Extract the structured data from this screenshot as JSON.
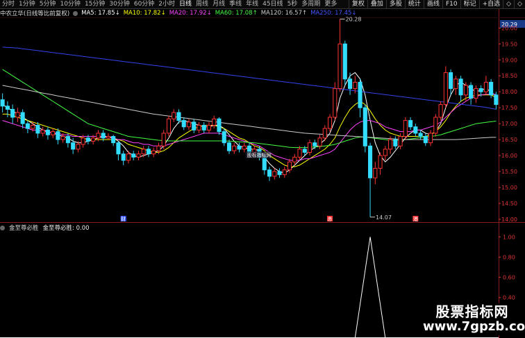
{
  "toolbar": {
    "periods": [
      "分时",
      "1分钟",
      "5分钟",
      "10分钟",
      "15分钟",
      "30分钟",
      "60分钟",
      "2小时",
      "日线",
      "周线",
      "月线",
      "季线",
      "年线",
      "45日线",
      "5秒",
      "多周期",
      "更多"
    ],
    "active_period": "日线",
    "right_buttons": [
      "复权",
      "叠加",
      "多股",
      "统计",
      "画线",
      "F10",
      "标记",
      "+自选",
      "◇",
      "◇"
    ]
  },
  "ma_legend": {
    "stock_title": "中农立华(日线等比前复权)",
    "items": [
      {
        "label": "MA5: 17.85↓",
        "color": "#ffffff"
      },
      {
        "label": "MA10: 17.82↓",
        "color": "#ffff00"
      },
      {
        "label": "MA20: 17.92↓",
        "color": "#ff44ff"
      },
      {
        "label": "MA60: 17.08↑",
        "color": "#44ff44"
      },
      {
        "label": "MA120: 16.57↑",
        "color": "#cccccc"
      },
      {
        "label": "MA250: 17.45↓",
        "color": "#4455ff"
      }
    ]
  },
  "price_axis": {
    "labels": [
      "20.29",
      "20.00",
      "19.50",
      "19.00",
      "18.50",
      "18.00",
      "17.50",
      "17.00",
      "16.50",
      "16.00",
      "15.50",
      "15.00",
      "14.50",
      "14.00"
    ],
    "current": "20.29"
  },
  "annotations": {
    "high_label": "20.28",
    "low_label": "14.07",
    "marker_1": "财",
    "marker_2": "赤",
    "marker_3": "港",
    "chip_label": "股标指标网"
  },
  "indicator": {
    "name": "金至尊必胜",
    "line_label": "金至尊必胜: 0.00",
    "axis_labels": [
      "1.00",
      "0.80",
      "0.60",
      "0.40",
      "0.20"
    ]
  },
  "watermark": {
    "line1": "股票指标网",
    "line2": "www.7gpzb.com"
  },
  "chart_data": {
    "type": "candlestick",
    "up_color": "#ff3333",
    "down_color": "#33ddff",
    "candles": [
      [
        17.75,
        17.55,
        17.95,
        17.35
      ],
      [
        17.55,
        17.45,
        17.7,
        17.2
      ],
      [
        17.45,
        17.2,
        17.6,
        17.0
      ],
      [
        17.2,
        17.35,
        17.5,
        17.05
      ],
      [
        17.35,
        17.0,
        17.45,
        16.85
      ],
      [
        17.0,
        16.85,
        17.1,
        16.7
      ],
      [
        16.85,
        16.95,
        17.05,
        16.75
      ],
      [
        16.95,
        16.7,
        17.05,
        16.55
      ],
      [
        16.7,
        16.8,
        16.9,
        16.6
      ],
      [
        16.8,
        16.65,
        16.9,
        16.5
      ],
      [
        16.65,
        16.75,
        16.85,
        16.55
      ],
      [
        16.75,
        16.5,
        16.85,
        16.35
      ],
      [
        16.5,
        16.6,
        16.7,
        16.4
      ],
      [
        16.6,
        16.4,
        16.7,
        16.25
      ],
      [
        16.4,
        16.2,
        16.55,
        16.05
      ],
      [
        16.2,
        16.35,
        16.45,
        16.1
      ],
      [
        16.35,
        16.55,
        16.65,
        16.25
      ],
      [
        16.55,
        16.45,
        16.65,
        16.35
      ],
      [
        16.45,
        16.55,
        16.65,
        16.35
      ],
      [
        16.55,
        16.7,
        16.8,
        16.45
      ],
      [
        16.7,
        16.55,
        16.8,
        16.45
      ],
      [
        16.55,
        16.6,
        16.7,
        16.5
      ],
      [
        16.6,
        16.4,
        16.65,
        16.3
      ],
      [
        16.4,
        16.05,
        16.45,
        15.85
      ],
      [
        16.05,
        15.85,
        16.15,
        15.7
      ],
      [
        15.85,
        16.05,
        16.15,
        15.75
      ],
      [
        16.05,
        15.95,
        16.15,
        15.85
      ],
      [
        15.95,
        16.05,
        16.15,
        15.85
      ],
      [
        16.05,
        16.2,
        16.3,
        15.95
      ],
      [
        16.2,
        16.05,
        16.3,
        15.95
      ],
      [
        16.05,
        16.15,
        16.25,
        15.95
      ],
      [
        16.15,
        16.3,
        16.4,
        16.05
      ],
      [
        16.3,
        16.7,
        16.8,
        16.2
      ],
      [
        16.7,
        17.15,
        17.25,
        16.6
      ],
      [
        17.15,
        17.35,
        17.45,
        17.05
      ],
      [
        17.35,
        17.1,
        17.45,
        17.0
      ],
      [
        17.1,
        16.9,
        17.2,
        16.8
      ],
      [
        16.9,
        17.05,
        17.15,
        16.8
      ],
      [
        17.05,
        16.8,
        17.15,
        16.7
      ],
      [
        16.8,
        16.95,
        17.05,
        16.7
      ],
      [
        16.95,
        16.8,
        17.05,
        16.7
      ],
      [
        16.8,
        16.95,
        17.05,
        16.7
      ],
      [
        16.95,
        17.15,
        17.25,
        16.85
      ],
      [
        17.15,
        16.75,
        17.2,
        16.65
      ],
      [
        16.75,
        16.4,
        16.85,
        16.3
      ],
      [
        16.4,
        16.15,
        16.5,
        16.05
      ],
      [
        16.15,
        16.3,
        16.4,
        16.05
      ],
      [
        16.3,
        16.2,
        16.4,
        16.1
      ],
      [
        16.2,
        16.3,
        16.4,
        16.1
      ],
      [
        16.3,
        16.1,
        16.4,
        16.0
      ],
      [
        16.1,
        16.2,
        16.3,
        16.0
      ],
      [
        16.2,
        15.95,
        16.3,
        15.85
      ],
      [
        15.95,
        15.55,
        16.05,
        15.4
      ],
      [
        15.55,
        15.35,
        15.65,
        15.2
      ],
      [
        15.35,
        15.5,
        15.6,
        15.25
      ],
      [
        15.5,
        15.4,
        15.6,
        15.3
      ],
      [
        15.4,
        15.55,
        15.65,
        15.3
      ],
      [
        15.55,
        15.8,
        15.9,
        15.45
      ],
      [
        15.8,
        15.95,
        16.05,
        15.7
      ],
      [
        15.95,
        16.2,
        16.3,
        15.85
      ],
      [
        16.2,
        16.1,
        16.3,
        16.0
      ],
      [
        16.1,
        16.4,
        16.5,
        16.0
      ],
      [
        16.4,
        16.3,
        16.5,
        16.2
      ],
      [
        16.3,
        16.55,
        16.65,
        16.2
      ],
      [
        16.55,
        16.85,
        16.95,
        16.45
      ],
      [
        16.85,
        17.2,
        17.3,
        16.75
      ],
      [
        17.2,
        18.1,
        18.3,
        17.1
      ],
      [
        18.1,
        19.5,
        20.28,
        18.0
      ],
      [
        19.5,
        18.4,
        19.6,
        18.2
      ],
      [
        18.4,
        18.1,
        18.6,
        17.9
      ],
      [
        18.1,
        18.3,
        18.5,
        17.95
      ],
      [
        18.3,
        17.5,
        18.4,
        17.2
      ],
      [
        17.5,
        16.3,
        17.6,
        16.1
      ],
      [
        16.3,
        15.3,
        16.4,
        14.07
      ],
      [
        15.3,
        15.6,
        15.8,
        15.1
      ],
      [
        15.6,
        16.0,
        16.1,
        15.4
      ],
      [
        16.0,
        16.2,
        16.3,
        15.85
      ],
      [
        16.2,
        16.5,
        16.6,
        16.05
      ],
      [
        16.5,
        16.3,
        16.6,
        16.2
      ],
      [
        16.3,
        16.6,
        16.7,
        16.2
      ],
      [
        16.6,
        17.1,
        17.2,
        16.5
      ],
      [
        17.1,
        16.9,
        17.2,
        16.8
      ],
      [
        16.9,
        16.7,
        17.0,
        16.6
      ],
      [
        16.7,
        16.6,
        16.8,
        16.5
      ],
      [
        16.6,
        16.4,
        16.7,
        16.3
      ],
      [
        16.4,
        16.7,
        16.8,
        16.3
      ],
      [
        16.7,
        17.2,
        17.3,
        16.6
      ],
      [
        17.2,
        17.6,
        17.7,
        17.1
      ],
      [
        17.6,
        18.6,
        18.8,
        17.5
      ],
      [
        18.6,
        18.1,
        18.7,
        17.9
      ],
      [
        18.1,
        18.4,
        18.5,
        17.9
      ],
      [
        18.4,
        17.9,
        18.5,
        17.7
      ],
      [
        17.9,
        18.2,
        18.3,
        17.7
      ],
      [
        18.2,
        17.8,
        18.3,
        17.6
      ],
      [
        17.8,
        18.1,
        18.2,
        17.65
      ],
      [
        18.1,
        18.0,
        18.2,
        17.85
      ],
      [
        18.0,
        18.3,
        18.5,
        17.9
      ],
      [
        18.3,
        17.9,
        18.4,
        17.8
      ],
      [
        17.9,
        17.6,
        18.0,
        17.45
      ]
    ],
    "ma_series": [
      {
        "color": "#ffffff",
        "values": [
          17.6,
          17.5,
          17.4,
          17.3,
          17.2,
          17.1,
          17.0,
          16.9,
          16.8,
          16.75,
          16.7,
          16.65,
          16.6,
          16.55,
          16.45,
          16.4,
          16.4,
          16.45,
          16.5,
          16.55,
          16.6,
          16.6,
          16.55,
          16.45,
          16.3,
          16.1,
          16.0,
          15.95,
          16.0,
          16.05,
          16.1,
          16.15,
          16.3,
          16.55,
          16.85,
          17.05,
          17.1,
          17.05,
          17.0,
          16.95,
          16.9,
          16.9,
          16.95,
          16.95,
          16.85,
          16.65,
          16.45,
          16.3,
          16.25,
          16.2,
          16.2,
          16.15,
          15.95,
          15.75,
          15.6,
          15.5,
          15.45,
          15.55,
          15.7,
          15.85,
          16.0,
          16.15,
          16.25,
          16.35,
          16.5,
          16.7,
          17.1,
          17.8,
          18.2,
          18.5,
          18.6,
          18.4,
          17.9,
          17.1,
          16.4,
          16.0,
          15.8,
          15.95,
          16.15,
          16.35,
          16.55,
          16.7,
          16.8,
          16.8,
          16.7,
          16.65,
          16.75,
          17.0,
          17.5,
          17.9,
          18.2,
          18.3,
          18.2,
          18.1,
          18.0,
          18.05,
          18.1,
          18.0,
          17.85
        ]
      },
      {
        "color": "#ffff00",
        "values": [
          17.3,
          17.3,
          17.25,
          17.2,
          17.15,
          17.1,
          17.05,
          17.0,
          16.95,
          16.9,
          16.85,
          16.8,
          16.75,
          16.7,
          16.65,
          16.6,
          16.55,
          16.5,
          16.5,
          16.5,
          16.5,
          16.5,
          16.5,
          16.5,
          16.45,
          16.35,
          16.3,
          16.25,
          16.2,
          16.15,
          16.1,
          16.1,
          16.15,
          16.25,
          16.4,
          16.55,
          16.65,
          16.75,
          16.85,
          16.9,
          16.95,
          16.95,
          16.95,
          16.9,
          16.85,
          16.75,
          16.65,
          16.55,
          16.5,
          16.4,
          16.3,
          16.25,
          16.15,
          16.0,
          15.9,
          15.8,
          15.7,
          15.65,
          15.65,
          15.7,
          15.8,
          15.9,
          16.0,
          16.1,
          16.2,
          16.35,
          16.55,
          16.9,
          17.2,
          17.45,
          17.6,
          17.7,
          17.6,
          17.4,
          17.15,
          16.95,
          16.8,
          16.7,
          16.65,
          16.6,
          16.6,
          16.6,
          16.6,
          16.6,
          16.6,
          16.65,
          16.75,
          16.9,
          17.1,
          17.35,
          17.55,
          17.7,
          17.8,
          17.85,
          17.9,
          17.9,
          17.9,
          17.9,
          17.82
        ]
      },
      {
        "color": "#ff44ff",
        "values": [
          17.1,
          17.05,
          17.0,
          16.95,
          16.9,
          16.85,
          16.8,
          16.8,
          16.75,
          16.75,
          16.7,
          16.7,
          16.65,
          16.65,
          16.6,
          16.6,
          16.6,
          16.6,
          16.6,
          16.6,
          16.6,
          16.55,
          16.55,
          16.5,
          16.5,
          16.45,
          16.4,
          16.4,
          16.35,
          16.35,
          16.3,
          16.3,
          16.3,
          16.35,
          16.4,
          16.45,
          16.5,
          16.55,
          16.6,
          16.65,
          16.7,
          16.7,
          16.7,
          16.7,
          16.65,
          16.6,
          16.55,
          16.5,
          16.45,
          16.4,
          16.35,
          16.3,
          16.2,
          16.1,
          16.0,
          15.95,
          15.9,
          15.85,
          15.85,
          15.85,
          15.9,
          15.9,
          15.95,
          16.0,
          16.05,
          16.1,
          16.2,
          16.4,
          16.6,
          16.8,
          16.95,
          17.05,
          17.1,
          17.1,
          17.05,
          17.0,
          16.9,
          16.85,
          16.8,
          16.75,
          16.75,
          16.75,
          16.8,
          16.8,
          16.85,
          16.9,
          16.95,
          17.05,
          17.2,
          17.35,
          17.5,
          17.6,
          17.7,
          17.8,
          17.85,
          17.9,
          17.92,
          17.92,
          17.92
        ]
      },
      {
        "color": "#44ff44",
        "values": [
          18.7,
          18.6,
          18.5,
          18.4,
          18.3,
          18.2,
          18.1,
          18.0,
          17.9,
          17.8,
          17.7,
          17.6,
          17.5,
          17.4,
          17.3,
          17.2,
          17.1,
          17.0,
          16.95,
          16.9,
          16.85,
          16.8,
          16.75,
          16.7,
          16.65,
          16.6,
          16.58,
          16.56,
          16.54,
          16.52,
          16.5,
          16.48,
          16.47,
          16.46,
          16.46,
          16.46,
          16.46,
          16.46,
          16.46,
          16.46,
          16.46,
          16.46,
          16.46,
          16.46,
          16.46,
          16.45,
          16.44,
          16.43,
          16.42,
          16.41,
          16.4,
          16.38,
          16.36,
          16.34,
          16.32,
          16.3,
          16.28,
          16.26,
          16.25,
          16.25,
          16.25,
          16.26,
          16.27,
          16.28,
          16.3,
          16.32,
          16.35,
          16.4,
          16.45,
          16.5,
          16.55,
          16.58,
          16.58,
          16.56,
          16.54,
          16.52,
          16.5,
          16.48,
          16.48,
          16.48,
          16.5,
          16.52,
          16.54,
          16.56,
          16.58,
          16.6,
          16.62,
          16.65,
          16.7,
          16.75,
          16.8,
          16.85,
          16.9,
          16.95,
          17.0,
          17.02,
          17.04,
          17.06,
          17.08
        ]
      },
      {
        "color": "#cccccc",
        "values": [
          18.2,
          18.17,
          18.14,
          18.11,
          18.08,
          18.05,
          18.02,
          17.99,
          17.96,
          17.93,
          17.9,
          17.87,
          17.84,
          17.81,
          17.78,
          17.75,
          17.72,
          17.69,
          17.66,
          17.63,
          17.6,
          17.57,
          17.54,
          17.51,
          17.48,
          17.45,
          17.42,
          17.39,
          17.36,
          17.33,
          17.3,
          17.28,
          17.26,
          17.24,
          17.22,
          17.2,
          17.18,
          17.16,
          17.14,
          17.12,
          17.1,
          17.08,
          17.06,
          17.04,
          17.02,
          17.0,
          16.98,
          16.96,
          16.94,
          16.92,
          16.9,
          16.88,
          16.86,
          16.84,
          16.82,
          16.8,
          16.78,
          16.76,
          16.74,
          16.72,
          16.7,
          16.69,
          16.68,
          16.67,
          16.66,
          16.65,
          16.64,
          16.63,
          16.62,
          16.61,
          16.6,
          16.59,
          16.58,
          16.57,
          16.56,
          16.55,
          16.54,
          16.53,
          16.52,
          16.51,
          16.5,
          16.5,
          16.5,
          16.5,
          16.5,
          16.5,
          16.5,
          16.5,
          16.5,
          16.5,
          16.5,
          16.51,
          16.52,
          16.53,
          16.54,
          16.55,
          16.56,
          16.57,
          16.57
        ]
      },
      {
        "color": "#3344ee",
        "values": [
          19.4,
          19.39,
          19.38,
          19.37,
          19.35,
          19.33,
          19.31,
          19.29,
          19.27,
          19.25,
          19.23,
          19.21,
          19.19,
          19.17,
          19.15,
          19.13,
          19.11,
          19.09,
          19.07,
          19.05,
          19.03,
          19.01,
          18.99,
          18.97,
          18.95,
          18.93,
          18.91,
          18.89,
          18.87,
          18.85,
          18.83,
          18.81,
          18.79,
          18.77,
          18.75,
          18.73,
          18.71,
          18.69,
          18.67,
          18.65,
          18.63,
          18.61,
          18.59,
          18.57,
          18.55,
          18.53,
          18.51,
          18.49,
          18.47,
          18.45,
          18.43,
          18.41,
          18.39,
          18.37,
          18.35,
          18.33,
          18.31,
          18.29,
          18.27,
          18.25,
          18.23,
          18.21,
          18.19,
          18.17,
          18.15,
          18.13,
          18.11,
          18.09,
          18.07,
          18.05,
          18.03,
          18.01,
          17.99,
          17.97,
          17.95,
          17.93,
          17.91,
          17.89,
          17.87,
          17.85,
          17.83,
          17.81,
          17.79,
          17.77,
          17.75,
          17.73,
          17.71,
          17.69,
          17.67,
          17.65,
          17.63,
          17.61,
          17.59,
          17.57,
          17.55,
          17.53,
          17.51,
          17.48,
          17.45
        ]
      }
    ],
    "ylim": [
      14.0,
      20.29
    ],
    "indicator_values": {
      "spike_index": 73,
      "spike_value": 1.0
    },
    "indicator_ylim": [
      0,
      1.05
    ]
  }
}
